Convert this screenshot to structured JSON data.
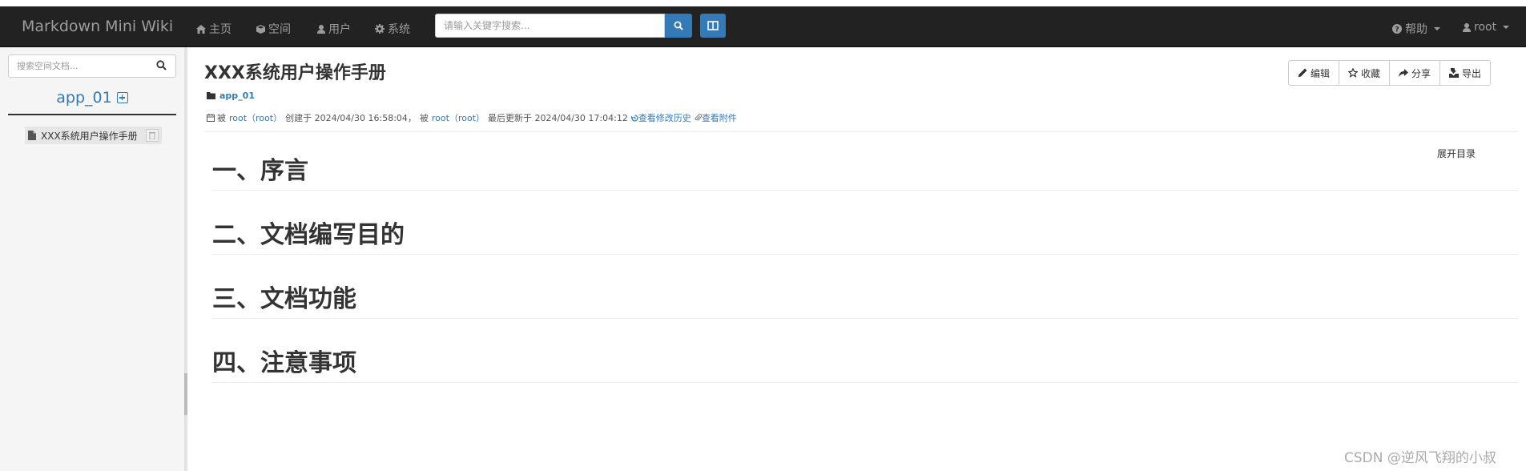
{
  "navbar": {
    "brand": "Markdown Mini Wiki",
    "items": [
      {
        "icon": "home-icon",
        "label": "主页"
      },
      {
        "icon": "cube-icon",
        "label": "空间"
      },
      {
        "icon": "user-icon",
        "label": "用户"
      },
      {
        "icon": "gear-icon",
        "label": "系统"
      }
    ],
    "search_placeholder": "请输入关键字搜索...",
    "help_label": "帮助",
    "user_label": "root",
    "bg_color": "#222222",
    "accent_color": "#337ab7"
  },
  "sidebar": {
    "search_placeholder": "搜索空间文档...",
    "space_name": "app_01",
    "tree_items": [
      {
        "label": "XXX系统用户操作手册"
      }
    ]
  },
  "document": {
    "title": "XXX系统用户操作手册",
    "breadcrumb": "app_01",
    "meta": {
      "by": "被",
      "creator": "root（root）",
      "created_text": "创建于 2024/04/30 16:58:04，",
      "by2": "被",
      "updater": "root（root）",
      "updated_text": "最后更新于 2024/04/30 17:04:12",
      "history_link": "查看修改历史",
      "attachments_link": "查看附件"
    },
    "actions": [
      {
        "icon": "pencil-icon",
        "label": "编辑"
      },
      {
        "icon": "star-icon",
        "label": "收藏"
      },
      {
        "icon": "share-icon",
        "label": "分享"
      },
      {
        "icon": "export-icon",
        "label": "导出"
      }
    ],
    "toc_toggle": "展开目录",
    "headings": [
      "一、序言",
      "二、文档编写目的",
      "三、文档功能",
      "四、注意事项"
    ]
  },
  "watermark": "CSDN @逆风飞翔的小叔"
}
